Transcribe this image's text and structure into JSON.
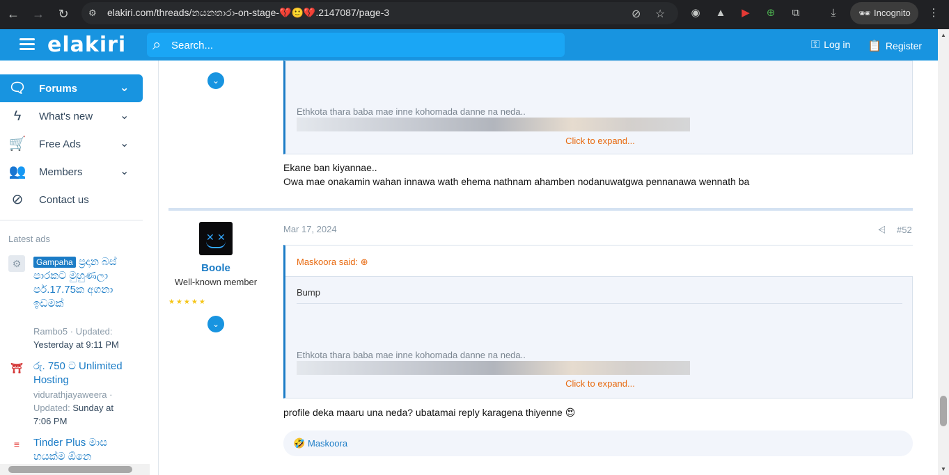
{
  "browser": {
    "url": "elakiri.com/threads/නයනතාරා-on-stage-💔🙂💔.2147087/page-3",
    "incognito_label": "Incognito"
  },
  "header": {
    "logo": "elakiri",
    "search_placeholder": "Search...",
    "login_label": "Log in",
    "register_label": "Register",
    "accent_color": "#1894e0"
  },
  "sidebar": {
    "items": [
      {
        "label": "Forums",
        "icon": "forums-icon"
      },
      {
        "label": "What's new",
        "icon": "bolt-icon"
      },
      {
        "label": "Free Ads",
        "icon": "cart-icon"
      },
      {
        "label": "Members",
        "icon": "members-icon"
      },
      {
        "label": "Contact us",
        "icon": "compass-icon"
      }
    ],
    "latest_ads_heading": "Latest ads",
    "ads": [
      {
        "badge": "Gampaha",
        "title": "ප්‍රදාන බස් පාරකට මුහුණලා පර්.17.75ක අගනා ඉඩමක්",
        "author": "Rambo5",
        "updated_label": "Updated:",
        "updated": "Yesterday at 9:11 PM"
      },
      {
        "title": "රු. 750 ට Unlimited Hosting",
        "author": "vidurathjayaweera",
        "updated_label": "Updated:",
        "updated": "Sunday at 7:06 PM"
      },
      {
        "title": "Tinder Plus මාස හයක්ම ඕනෙ"
      }
    ]
  },
  "posts": {
    "prev": {
      "quote_text": "Ethkota thara baba mae inne kohomada danne na neda..",
      "expand_label": "Click to expand...",
      "message_line1": "Ekane ban kiyannae..",
      "message_line2": "Owa mae onakamin wahan innawa wath ehema nathnam ahamben nodanuwatgwa pennanawa wennath ba"
    },
    "current": {
      "username": "Boole",
      "user_title": "Well-known member",
      "stars": "★★★★★",
      "date": "Mar 17, 2024",
      "post_number": "#52",
      "quote_author": "Maskoora said:",
      "quote_bump": "Bump",
      "quote_text": "Ethkota thara baba mae inne kohomada danne na neda..",
      "expand_label": "Click to expand...",
      "message": "profile deka maaru una neda? ubatamai reply karagena thiyenne 😍",
      "reaction_user": "Maskoora"
    }
  }
}
